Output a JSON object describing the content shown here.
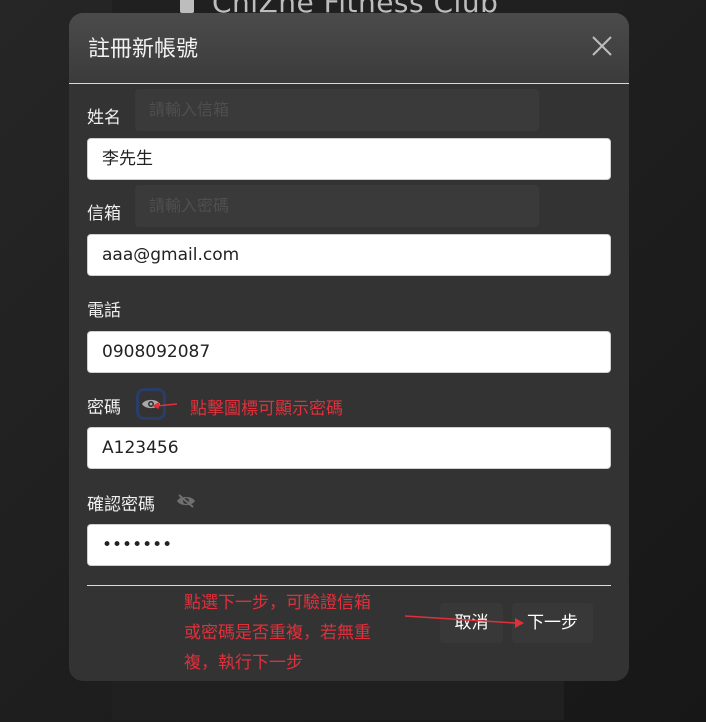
{
  "background": {
    "title": "ChiZhe Fitness Club",
    "ghost_email_placeholder": "請輸入信箱",
    "ghost_password_placeholder": "請輸入密碼"
  },
  "modal": {
    "title": "註冊新帳號",
    "close_icon": "close-icon",
    "fields": {
      "name": {
        "label": "姓名",
        "value": "李先生"
      },
      "email": {
        "label": "信箱",
        "value": "aaa@gmail.com"
      },
      "phone": {
        "label": "電話",
        "value": "0908092087"
      },
      "password": {
        "label": "密碼",
        "value": "A123456",
        "icon": "eye-icon"
      },
      "confirm_password": {
        "label": "確認密碼",
        "value": "•••••••",
        "icon": "eye-slash-icon"
      }
    },
    "buttons": {
      "cancel": "取消",
      "next": "下一步"
    }
  },
  "annotations": {
    "eye_tip": "點擊圖標可顯示密碼",
    "next_tip_lines": [
      "點選下一步，可驗證信箱",
      "或密碼是否重複，若無重",
      "複，執行下一步"
    ]
  },
  "colors": {
    "annotation": "#e0303b",
    "highlight_border": "#2a3d66",
    "modal_bg": "#333333",
    "page_bg": "#1f1f1f"
  }
}
